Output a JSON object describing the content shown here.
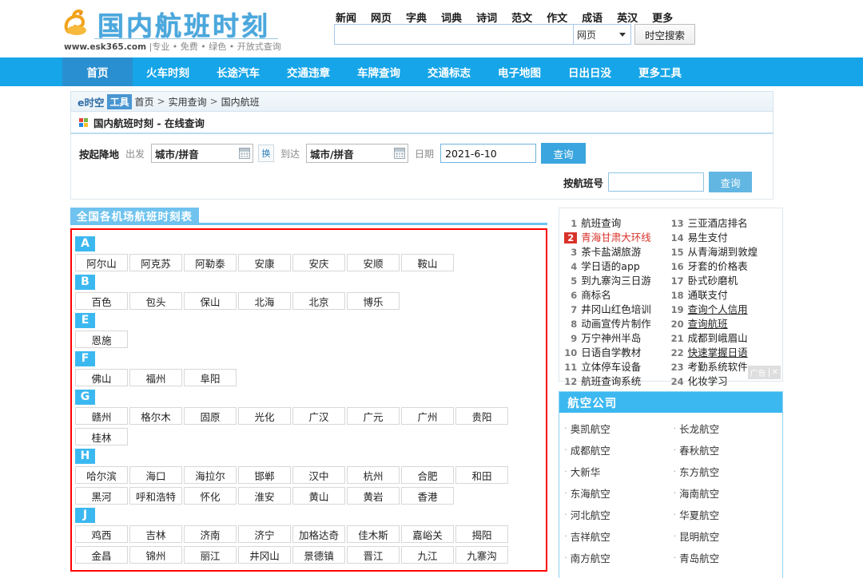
{
  "header": {
    "logo": {
      "title": "国内航班时刻",
      "domain": "www.esk365.com",
      "tagline": "|专业 • 免费 • 绿色 • 开放式查询",
      "icon": "goose-logo-icon"
    },
    "search_links": [
      "新闻",
      "网页",
      "字典",
      "词典",
      "诗词",
      "范文",
      "作文",
      "成语",
      "英汉",
      "更多"
    ],
    "search": {
      "value": "",
      "placeholder": "",
      "scope_selected": "网页",
      "button_label": "时空搜索"
    }
  },
  "nav": {
    "items": [
      {
        "label": "首页",
        "active": true
      },
      {
        "label": "火车时刻",
        "active": false
      },
      {
        "label": "长途汽车",
        "active": false
      },
      {
        "label": "交通违章",
        "active": false
      },
      {
        "label": "车牌查询",
        "active": false
      },
      {
        "label": "交通标志",
        "active": false
      },
      {
        "label": "电子地图",
        "active": false
      },
      {
        "label": "日出日没",
        "active": false
      },
      {
        "label": "更多工具",
        "active": false
      }
    ]
  },
  "breadcrumb": {
    "brand": "e时空",
    "badge": "工具",
    "items": [
      "首页",
      "实用查询",
      "国内航班"
    ],
    "sep": ">"
  },
  "section_title": "国内航班时刻 - 在线查询",
  "form": {
    "mode_label": "按起降地",
    "depart_label": "出发",
    "depart_value": "城市/拼音",
    "swap_label": "换",
    "arrive_label": "到达",
    "arrive_value": "城市/拼音",
    "date_label": "日期",
    "date_value": "2021-6-10",
    "query_label": "查询",
    "flightno_label": "按航班号",
    "flightno_value": "",
    "flightno_query_label": "查询"
  },
  "airport_list": {
    "tab_label": "全国各机场航班时刻表",
    "groups": [
      {
        "letter": "A",
        "cities": [
          "阿尔山",
          "阿克苏",
          "阿勒泰",
          "安康",
          "安庆",
          "安顺",
          "鞍山"
        ]
      },
      {
        "letter": "B",
        "cities": [
          "百色",
          "包头",
          "保山",
          "北海",
          "北京",
          "博乐"
        ]
      },
      {
        "letter": "E",
        "cities": [
          "恩施"
        ]
      },
      {
        "letter": "F",
        "cities": [
          "佛山",
          "福州",
          "阜阳"
        ]
      },
      {
        "letter": "G",
        "cities": [
          "赣州",
          "格尔木",
          "固原",
          "光化",
          "广汉",
          "广元",
          "广州",
          "贵阳",
          "桂林"
        ]
      },
      {
        "letter": "H",
        "cities": [
          "哈尔滨",
          "海口",
          "海拉尔",
          "邯郸",
          "汉中",
          "杭州",
          "合肥",
          "和田",
          "黑河",
          "呼和浩特",
          "怀化",
          "淮安",
          "黄山",
          "黄岩",
          "香港"
        ]
      },
      {
        "letter": "J",
        "cities": [
          "鸡西",
          "吉林",
          "济南",
          "济宁",
          "加格达奇",
          "佳木斯",
          "嘉峪关",
          "揭阳",
          "金昌",
          "锦州",
          "丽江",
          "井冈山",
          "景德镇",
          "晋江",
          "九江",
          "九寨沟"
        ]
      }
    ]
  },
  "hot_list": {
    "column_left": [
      {
        "rank": "1",
        "text": "航班查询",
        "hot": false,
        "underline": false
      },
      {
        "rank": "2",
        "text": "青海甘肃大环线",
        "hot": true,
        "underline": false
      },
      {
        "rank": "3",
        "text": "茶卡盐湖旅游",
        "hot": false,
        "underline": false
      },
      {
        "rank": "4",
        "text": "学日语的app",
        "hot": false,
        "underline": false
      },
      {
        "rank": "5",
        "text": "到九寨沟三日游",
        "hot": false,
        "underline": false
      },
      {
        "rank": "6",
        "text": "商标名",
        "hot": false,
        "underline": false
      },
      {
        "rank": "7",
        "text": "井冈山红色培训",
        "hot": false,
        "underline": false
      },
      {
        "rank": "8",
        "text": "动画宣传片制作",
        "hot": false,
        "underline": false
      },
      {
        "rank": "9",
        "text": "万宁神州半岛",
        "hot": false,
        "underline": false
      },
      {
        "rank": "10",
        "text": "日语自学教材",
        "hot": false,
        "underline": false
      },
      {
        "rank": "11",
        "text": "立体停车设备",
        "hot": false,
        "underline": false
      },
      {
        "rank": "12",
        "text": "航班查询系统",
        "hot": false,
        "underline": false
      }
    ],
    "column_right": [
      {
        "rank": "13",
        "text": "三亚酒店排名",
        "hot": false,
        "underline": false
      },
      {
        "rank": "14",
        "text": "易生支付",
        "hot": false,
        "underline": false
      },
      {
        "rank": "15",
        "text": "从青海湖到敦煌",
        "hot": false,
        "underline": false
      },
      {
        "rank": "16",
        "text": "牙套的价格表",
        "hot": false,
        "underline": false
      },
      {
        "rank": "17",
        "text": "卧式砂磨机",
        "hot": false,
        "underline": false
      },
      {
        "rank": "18",
        "text": "通联支付",
        "hot": false,
        "underline": false
      },
      {
        "rank": "19",
        "text": "查询个人信用",
        "hot": false,
        "underline": true
      },
      {
        "rank": "20",
        "text": "查询航班",
        "hot": false,
        "underline": true
      },
      {
        "rank": "21",
        "text": "成都到峨眉山",
        "hot": false,
        "underline": false
      },
      {
        "rank": "22",
        "text": "快速掌握日语",
        "hot": false,
        "underline": true
      },
      {
        "rank": "23",
        "text": "考勤系统软件",
        "hot": false,
        "underline": false
      },
      {
        "rank": "24",
        "text": "化妆学习",
        "hot": false,
        "underline": false
      }
    ],
    "ad_label": "广告",
    "ad_close": "✕"
  },
  "airlines": {
    "title": "航空公司",
    "items": [
      "奥凯航空",
      "长龙航空",
      "成都航空",
      "春秋航空",
      "大新华",
      "东方航空",
      "东海航空",
      "海南航空",
      "河北航空",
      "华夏航空",
      "吉祥航空",
      "昆明航空",
      "南方航空",
      "青岛航空"
    ]
  },
  "colors": {
    "nav_blue": "#16a5e8",
    "nav_active": "#2a8fd0",
    "letter_blue": "#3cb8f0",
    "highlight_red": "#ff0000",
    "hot_red": "#d9322a",
    "logo_blue": "#4aa8dd"
  }
}
